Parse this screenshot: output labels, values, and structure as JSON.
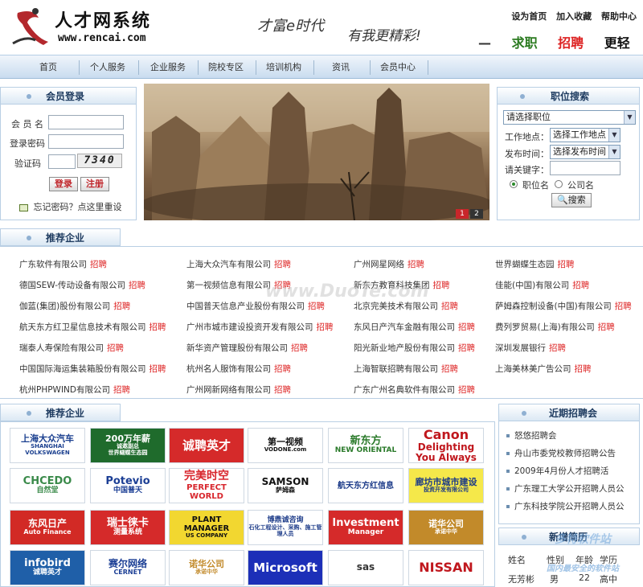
{
  "header": {
    "logo_title": "人才网系统",
    "logo_url": "www.rencai.com",
    "slogan_left": "才富e时代",
    "slogan_right": "有我更精彩!",
    "toplinks": [
      "设为首页",
      "加入收藏",
      "帮助中心"
    ],
    "dash": "—",
    "big_words": [
      "求职",
      "招聘",
      "更轻松"
    ]
  },
  "nav": [
    "首页",
    "个人服务",
    "企业服务",
    "院校专区",
    "培训机构",
    "资讯",
    "会员中心"
  ],
  "login": {
    "title": "会员登录",
    "username_label": "会 员 名",
    "password_label": "登录密码",
    "captcha_label": "验证码",
    "captcha_value": "7340",
    "login_btn": "登录",
    "register_btn": "注册",
    "forgot": "忘记密码？点这里重设"
  },
  "banner": {
    "pages": [
      "1",
      "2"
    ]
  },
  "job_search": {
    "title": "职位搜索",
    "position_select": "请选择职位",
    "location_label": "工作地点：",
    "location_select": "选择工作地点",
    "time_label": "发布时间：",
    "time_select": "选择发布时间",
    "keyword_label": "请关键字：",
    "radio_position": "职位名",
    "radio_company": "公司名",
    "search_btn": "搜索"
  },
  "recommend": {
    "title": "推荐企业",
    "hire_tag": "招聘",
    "companies": [
      "广东软件有限公司",
      "上海大众汽车有限公司",
      "广州网星网络",
      "世界蝴蝶生态园",
      "德国SEW-传动设备有限公司",
      "第一视频信息有限公司",
      "新东方教育科技集团",
      "佳能(中国)有限公司",
      "伽蓝(集团)股份有限公司",
      "中国普天信息产业股份有限公司",
      "北京完美技术有限公司",
      "萨姆森控制设备(中国)有限公司",
      "航天东方红卫星信息技术有限公司",
      "广州市城市建设投资开发有限公司",
      "东风日产汽车金融有限公司",
      "费列罗贸易(上海)有限公司",
      "瑞泰人寿保险有限公司",
      "新华资产管理股份有限公司",
      "阳光新业地产股份有限公司",
      "深圳发展银行",
      "中国国际海运集装箱股份有限公司",
      "杭州名人服饰有限公司",
      "上海智联招聘有限公司",
      "上海美林美广告公司",
      "杭州PHPWIND有限公司",
      "广州网新网络有限公司",
      "广东广州名典软件有限公司",
      ""
    ]
  },
  "logos": {
    "title": "推荐企业",
    "items": [
      [
        "上海大众汽车",
        "SHANGHAI VOLKSWAGEN"
      ],
      [
        "200万年薪",
        "诚邀副总",
        "世界蝴蝶生态园"
      ],
      [
        "诚聘英才"
      ],
      [
        "第一视频",
        "VODONE.com"
      ],
      [
        "新东方",
        "NEW ORIENTAL"
      ],
      [
        "Canon",
        "Delighting You Always"
      ],
      [
        "CHCEDO",
        "自然堂"
      ],
      [
        "Potevio",
        "中国普天"
      ],
      [
        "完美时空",
        "PERFECT WORLD"
      ],
      [
        "SAMSON",
        "萨姆森"
      ],
      [
        "航天东方红信息"
      ],
      [
        "廊坊市城市建设",
        "投资开发有限公司"
      ],
      [
        "东风日产",
        "Auto Finance"
      ],
      [
        "瑞士徕卡",
        "测量系统"
      ],
      [
        "PLANT MANAGER",
        "US COMPANY"
      ],
      [
        "博鼎诚咨询",
        "石化工程设计、采购、施工管理人员"
      ],
      [
        "Investment",
        "Manager"
      ],
      [
        "诺华公司",
        "承诺中华"
      ],
      [
        "infobird",
        "诚聘英才"
      ],
      [
        "赛尔网络",
        "CERNET"
      ],
      [
        "诺华公司",
        "承诺中华"
      ],
      [
        "Microsoft"
      ],
      [
        "sas"
      ],
      [
        "NISSAN"
      ]
    ]
  },
  "recent": {
    "title": "近期招聘会",
    "items": [
      "怒悠招聘会",
      "舟山市委党校教师招聘公告",
      "2009年4月份人才招聘活",
      "广东理工大学公开招聘人员公",
      "广东科技学院公开招聘人员公"
    ]
  },
  "resume": {
    "title": "新增简历",
    "headers": [
      "姓名",
      "性别",
      "年龄",
      "学历"
    ],
    "rows": [
      [
        "无芳彬",
        "男",
        "22",
        "高中"
      ]
    ]
  },
  "watermarks": {
    "center": "www.DuoTe.com",
    "corner_site": "多特软件站",
    "corner_tag": "国内最安全的软件站"
  },
  "colors": {
    "accent_red": "#dd2222",
    "nav_blue": "#c9dcef",
    "title_blue": "#1d3a5f"
  }
}
